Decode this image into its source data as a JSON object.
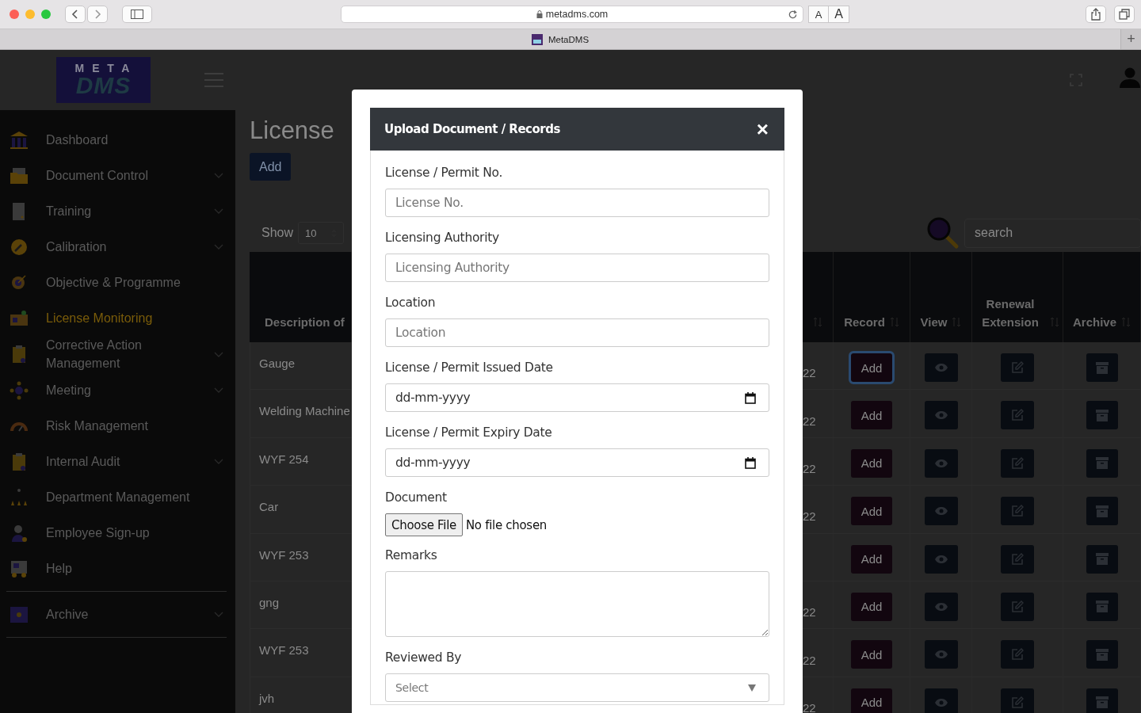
{
  "browser": {
    "url": "metadms.com",
    "text_size_buttons": [
      "A",
      "A"
    ],
    "tab": {
      "title": "MetaDMS"
    },
    "new_tab": "+"
  },
  "header": {
    "logo": {
      "top": "M E T A",
      "bottom": "DMS"
    }
  },
  "sidebar": {
    "items": [
      {
        "label": "Dashboard",
        "has_submenu": false,
        "selected": false
      },
      {
        "label": "Document Control",
        "has_submenu": true,
        "selected": false
      },
      {
        "label": "Training",
        "has_submenu": true,
        "selected": false
      },
      {
        "label": "Calibration",
        "has_submenu": true,
        "selected": false
      },
      {
        "label": "Objective & Programme",
        "has_submenu": false,
        "selected": false
      },
      {
        "label": "License Monitoring",
        "has_submenu": false,
        "selected": true
      },
      {
        "label": "Corrective Action Management",
        "has_submenu": true,
        "selected": false
      },
      {
        "label": "Meeting",
        "has_submenu": true,
        "selected": false
      },
      {
        "label": "Risk Management",
        "has_submenu": false,
        "selected": false
      },
      {
        "label": "Internal Audit",
        "has_submenu": true,
        "selected": false
      },
      {
        "label": "Department Management",
        "has_submenu": false,
        "selected": false
      },
      {
        "label": "Employee Sign-up",
        "has_submenu": false,
        "selected": false
      },
      {
        "label": "Help",
        "has_submenu": false,
        "selected": false
      }
    ],
    "footer_items": [
      {
        "label": "Archive",
        "has_submenu": true,
        "selected": false
      }
    ]
  },
  "page": {
    "title": "License",
    "add_button": "Add",
    "show_label": "Show",
    "page_size": "10",
    "search": {
      "placeholder": "search"
    }
  },
  "table": {
    "columns": [
      {
        "label": "Description of",
        "sort_icon": false
      },
      {
        "sort_icon": true
      },
      {
        "label": "Record",
        "sort_icon": true
      },
      {
        "label": "View",
        "sort_icon": true
      },
      {
        "label": "Renewal Extension",
        "sort_icon": true
      },
      {
        "label": "Archive",
        "sort_icon": true
      }
    ],
    "rows": [
      {
        "description": "Gauge",
        "date": "22",
        "record_button": "Add",
        "focused": true
      },
      {
        "description": "Welding Machine",
        "date": "22",
        "record_button": "Add",
        "focused": false
      },
      {
        "description": "WYF 254",
        "date": "22",
        "record_button": "Add",
        "focused": false
      },
      {
        "description": "Car",
        "date": "22",
        "record_button": "Add",
        "focused": false
      },
      {
        "description": "WYF 253",
        "record_button": "Add",
        "focused": false
      },
      {
        "description": "gng",
        "date": "22",
        "record_button": "Add",
        "focused": false
      },
      {
        "description": "WYF 253",
        "date": "22",
        "record_button": "Add",
        "focused": false
      },
      {
        "description": "jvh",
        "date": "22",
        "record_button": "Add",
        "focused": false
      }
    ]
  },
  "modal": {
    "title": "Upload Document / Records",
    "close": "×",
    "fields": [
      {
        "kind": "text",
        "label": "License / Permit No.",
        "placeholder": "License No."
      },
      {
        "kind": "text",
        "label": "Licensing Authority",
        "placeholder": "Licensing Authority"
      },
      {
        "kind": "text",
        "label": "Location",
        "placeholder": "Location"
      },
      {
        "kind": "date",
        "label": "License / Permit Issued Date",
        "value": "dd-mm-yyyy"
      },
      {
        "kind": "date",
        "label": "License / Permit Expiry Date",
        "value": "dd-mm-yyyy"
      },
      {
        "kind": "file",
        "label": "Document",
        "button": "Choose File",
        "status": "No file chosen"
      },
      {
        "kind": "textarea",
        "label": "Remarks"
      },
      {
        "kind": "select",
        "label": "Reviewed By",
        "placeholder": "Select"
      }
    ]
  }
}
